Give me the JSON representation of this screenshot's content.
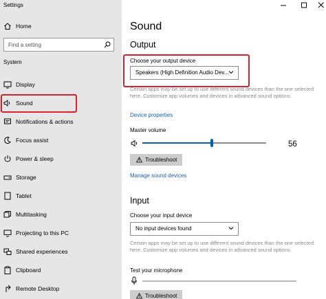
{
  "window": {
    "title": "Settings",
    "controls": [
      "minimize-icon",
      "maximize-icon",
      "close-icon"
    ]
  },
  "sidebar": {
    "home_label": "Home",
    "search_placeholder": "Find a setting",
    "section_label": "System",
    "items": [
      {
        "label": "Display",
        "icon": "display-icon"
      },
      {
        "label": "Sound",
        "icon": "speaker-icon",
        "selected": true
      },
      {
        "label": "Notifications & actions",
        "icon": "notifications-icon"
      },
      {
        "label": "Focus assist",
        "icon": "focus-assist-icon"
      },
      {
        "label": "Power & sleep",
        "icon": "power-icon"
      },
      {
        "label": "Storage",
        "icon": "storage-icon"
      },
      {
        "label": "Tablet",
        "icon": "tablet-icon"
      },
      {
        "label": "Multitasking",
        "icon": "multitasking-icon"
      },
      {
        "label": "Projecting to this PC",
        "icon": "projecting-icon"
      },
      {
        "label": "Shared experiences",
        "icon": "shared-experiences-icon"
      },
      {
        "label": "Clipboard",
        "icon": "clipboard-icon"
      },
      {
        "label": "Remote Desktop",
        "icon": "remote-desktop-icon"
      }
    ]
  },
  "main": {
    "page_title": "Sound",
    "output": {
      "heading": "Output",
      "device_label": "Choose your output device",
      "device_value": "Speakers (High Definition Audio Dev...",
      "info_text": "Certain apps may be set up to use different sound devices than the one selected here. Customize app volumes and devices in advanced sound options.",
      "device_properties_link": "Device properties",
      "volume_label": "Master volume",
      "volume_value": "56",
      "volume_fraction": 0.56,
      "troubleshoot_label": "Troubleshoot",
      "manage_devices_link": "Manage sound devices"
    },
    "input": {
      "heading": "Input",
      "device_label": "Choose your input device",
      "device_value": "No input devices found",
      "info_text": "Certain apps may be set up to use different sound devices than the one selected here. Customize app volumes and devices in advanced sound options.",
      "test_label": "Test your microphone",
      "troubleshoot_label": "Troubleshoot"
    }
  },
  "colors": {
    "sidebar_bg": "#e6e6e6",
    "accent": "#0063b1",
    "link": "#1a5fb4",
    "highlight": "#d9202b"
  }
}
